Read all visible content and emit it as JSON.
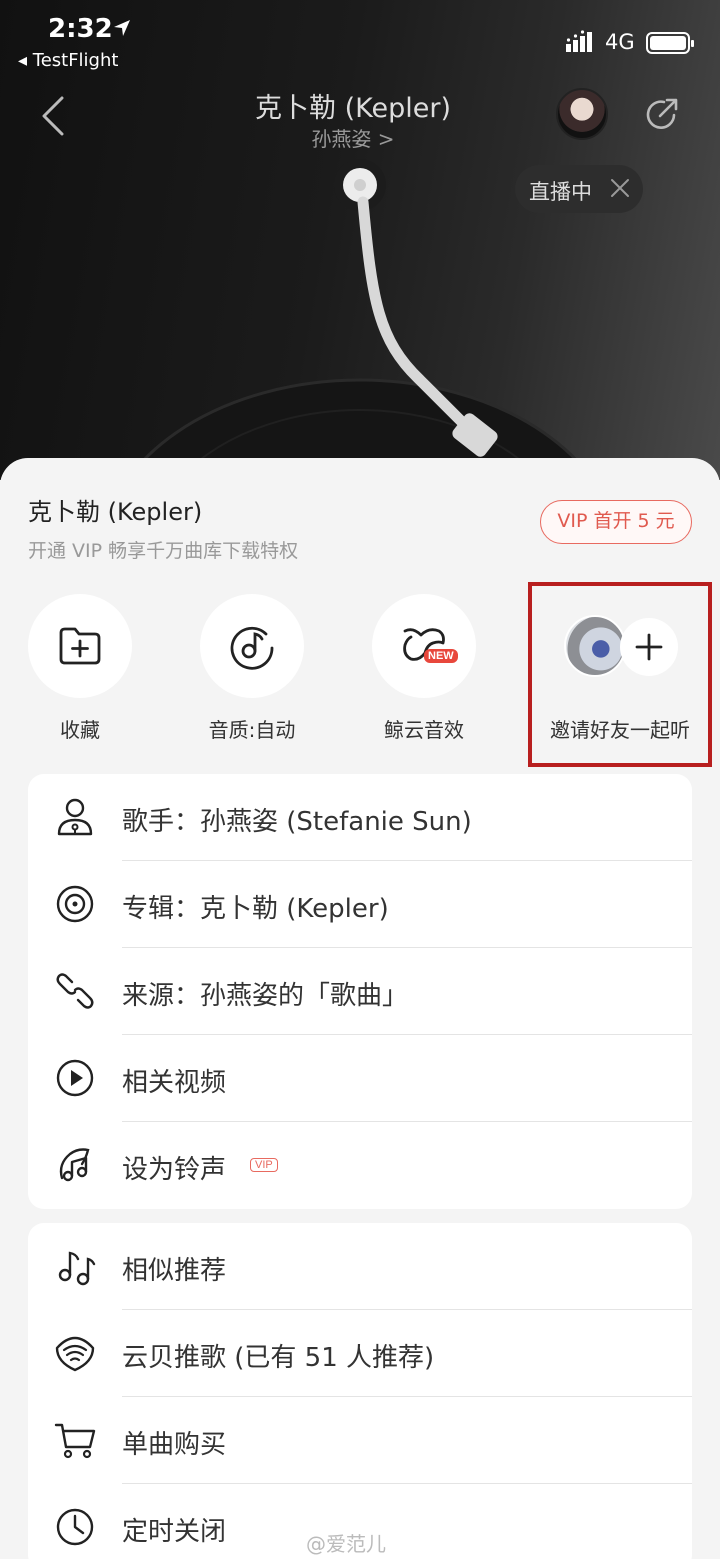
{
  "status_bar": {
    "time": "2:32",
    "back_app": "◂ TestFlight",
    "network": "4G"
  },
  "player": {
    "song_title": "克卜勒 (Kepler)",
    "artist_link": "孙燕姿 >",
    "live_label": "直播中"
  },
  "sheet": {
    "title": "克卜勒 (Kepler)",
    "subtitle": "开通 VIP 畅享千万曲库下载特权",
    "vip_button": "VIP 首开 5 元",
    "quick_actions": [
      {
        "label": "收藏",
        "icon": "folder-plus-icon"
      },
      {
        "label": "音质:自动",
        "icon": "music-quality-icon"
      },
      {
        "label": "鲸云音效",
        "icon": "whale-cloud-icon",
        "badge": "NEW"
      },
      {
        "label": "邀请好友一起听",
        "icon": "plus-icon"
      }
    ],
    "card1": [
      {
        "label": "歌手：孙燕姿 (Stefanie Sun)",
        "icon": "singer-icon"
      },
      {
        "label": "专辑：克卜勒 (Kepler)",
        "icon": "album-icon"
      },
      {
        "label": "来源：孙燕姿的「歌曲」",
        "icon": "link-icon"
      },
      {
        "label": "相关视频",
        "icon": "video-icon"
      },
      {
        "label": "设为铃声",
        "icon": "ringtone-icon",
        "tag": "VIP"
      }
    ],
    "card2": [
      {
        "label": "相似推荐",
        "icon": "similar-music-icon"
      },
      {
        "label": "云贝推歌 (已有 51 人推荐)",
        "icon": "yunbei-icon"
      },
      {
        "label": "单曲购买",
        "icon": "cart-icon"
      },
      {
        "label": "定时关闭",
        "icon": "clock-icon"
      }
    ]
  },
  "watermark": "@爱范儿",
  "colors": {
    "accent": "#e05a4f",
    "highlight_box": "#b81f1f"
  }
}
